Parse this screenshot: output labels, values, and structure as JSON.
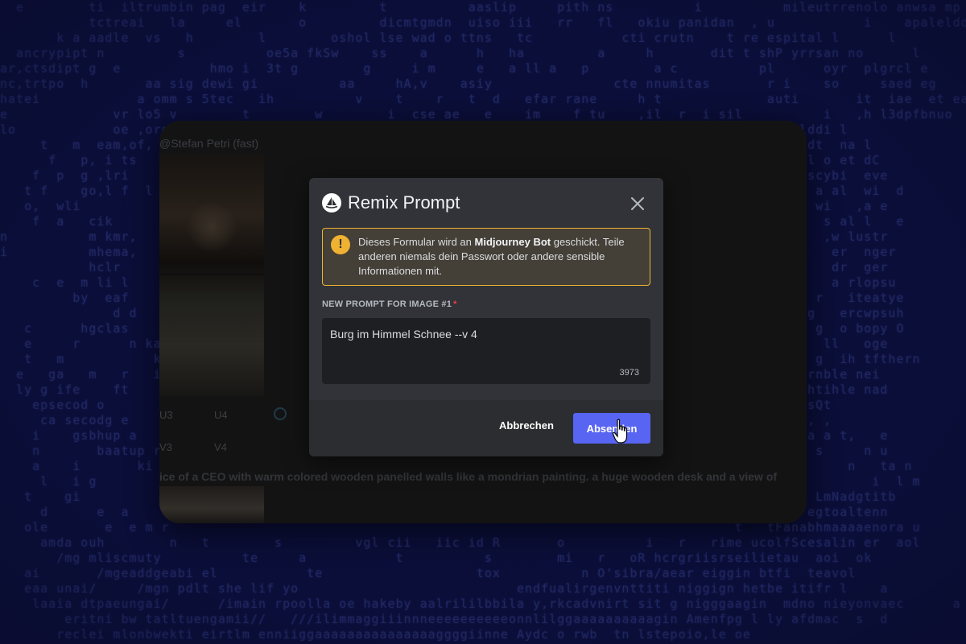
{
  "background": {
    "lines": [
      "  e        ti  iltrumbin pag  eir    k         t          aaslip     pith ns          i          mileutrrenolo anwsa mp se",
      "           tctreai   la     el       o         dicmtgmdn  uiso iii   rr   fl   okiu panidan  , u           i    apalelddweysf vafon",
      "       k a aadle  vs   h        l        oshol lse wad o ttns   tc           cti crutn    t re espital l      l         j iu a nysf vr",
      "  ancrypipt n         s          oe5a fkSw    ss    a      h   ha         a     h       dit t shP yrrsan no      l          a ir dWyi",
      "ar,ctsdipt g  e           hmo i  3t g        g     i m     e   a ll a   p        a c          pl      oyr  plgrcl e        p nesa",
      "nc,trtpo  h       aa sig dewi gi          aa     hA,v    asiy               cte nnumitas       r i    so     saed eg      ricte",
      "hatei            a omm s 5tec   ih          v    t    r   t  d   efar rane     h t             auti       it  iae  et ea c  hia",
      "e             vr lo5 v        t        w        i  cse ae   e    im    f tu    ,il  r  i sil          i   ,h l3dpfbnuo",
      "lo            oe ,oro                                                                     t ,ila illddi l",
      "     t   m  eam,of,                                                                      t      a s0dt  na l",
      "      f   p, i ts                                                                          t        l o et dC",
      "    f  p  g ,lri                                                                                  n scybi  eve",
      "   t f    go,l f  l                                                                         t  s     a al  wi  d",
      "   o,  wli                                                                                d hn   leo wi   ,a e",
      "    f  a   cik                                                                               wa    ,  s al l   e",
      "n          m kmr,                                                                            ptic     ,w lustr",
      "i          mhema,                                                                             o    n   er  nger",
      "           hclr       i                                                                       o    n   dr  ger",
      "    c  e  m li l                                                                            rt t       a rlopsu",
      "         by  eaf                                                                              p      r   iteatye",
      "              d d                                                                            2 s h  g   ercwpsuh",
      "   c      hgclas                                                                              o   lo g  o bopy O",
      "   e     r      n kaan                                                                        o       ll   oge",
      "   t   m           k erai                                                                    g   n   g  ih tfthern",
      "  e   ga   m   r   i  wcur                                                                      g o rnble nei",
      "  ly g ife    ft       a                                                                          mehtihle nad",
      "    epsecod o                                                                               rc mehehsQt",
      "     ca secodg e                                                                             esily w, ,",
      "    i    gsbhup a                                                                           d    ur a a t,   e",
      "    n       baatup re                                                                       t    b r s     n u",
      "    a    i       ki or                                                                     c t           n   ta n",
      "     l   i g                                                                                                i  l m",
      "   t    gi                                                                                   e       LmNadgtitb",
      "     d      e  a                                                                           a     me egtoaltenn",
      "   ole       e  e m r                                                                      t   tFanabhmaaaaenora u",
      "     amda ouh        n   t        s         vgl cii   iic id R       o          i   r   rime ucolfScesalin er  aol",
      "       /mg mliscmuty          te     a           t          s        mi   r   oR hcrgriisrseilietau  aoi  ok",
      "   ai       /mgeaddgeabi el           te                   tox          n O'sibra/aear eiggin btfi  teavol",
      "   eaa unai/     /mgn pdlt she lif yo                           endfualirgenvnttiti niggign hetbe itifr l    a",
      "    laaia dtpaeungai/      /imain rpoolla oe hakeby aalrililbbila y,rkcadvnirt sit g nigggaagin  mdno nieyonvaec      a",
      "        eritni bw tatltuengamii//   ///ilimmaggiiinnneeeeeeeeeeonnlilggaaaaaaaaaagin Amenfpg l ly afdmac  s  d",
      "       reclei mlonbwekti eirtlm enniiggaaaaaaaaaaaaaaaggggiinne Aydc o rwb  tn lstepoio,le oe"
    ]
  },
  "app": {
    "author": "@Stefan Petri (fast)",
    "buttons": [
      "U3",
      "U4",
      "V3",
      "V4"
    ],
    "prompt_line": "ice of a CEO with warm colored wooden panelled walls like a mondrian painting. a huge wooden desk and a view of"
  },
  "modal": {
    "title": "Remix Prompt",
    "warning": {
      "pre": "Dieses Formular wird an ",
      "bot": "Midjourney Bot",
      "post": " geschickt. Teile anderen niemals dein Passwort oder andere sensible Informationen mit."
    },
    "field_label": "NEW PROMPT FOR IMAGE #1",
    "required_mark": "*",
    "prompt_value": "Burg im Himmel Schnee --v 4",
    "char_count": "3973",
    "cancel_label": "Abbrechen",
    "submit_label": "Absenden"
  },
  "colors": {
    "accent": "#5865f2",
    "warning": "#f0b232",
    "modal_bg": "#313338",
    "page_bg": "#0b0f3a"
  }
}
